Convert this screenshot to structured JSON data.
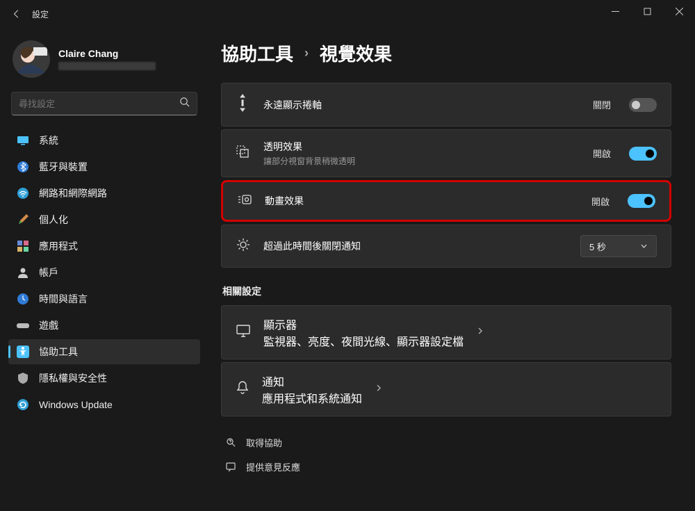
{
  "window": {
    "title": "設定"
  },
  "user": {
    "name": "Claire Chang"
  },
  "search": {
    "placeholder": "尋找設定"
  },
  "sidebar": {
    "items": [
      {
        "label": "系統"
      },
      {
        "label": "藍牙與裝置"
      },
      {
        "label": "網路和網際網路"
      },
      {
        "label": "個人化"
      },
      {
        "label": "應用程式"
      },
      {
        "label": "帳戶"
      },
      {
        "label": "時間與語言"
      },
      {
        "label": "遊戲"
      },
      {
        "label": "協助工具"
      },
      {
        "label": "隱私權與安全性"
      },
      {
        "label": "Windows Update"
      }
    ]
  },
  "breadcrumb": {
    "parent": "協助工具",
    "current": "視覺效果"
  },
  "settings": {
    "scrollbar": {
      "title": "永遠顯示捲軸",
      "state": "關閉"
    },
    "transparency": {
      "title": "透明效果",
      "sub": "讓部分視窗背景稍微透明",
      "state": "開啟"
    },
    "animation": {
      "title": "動畫效果",
      "state": "開啟"
    },
    "notify": {
      "title": "超過此時間後關閉通知",
      "value": "5 秒"
    }
  },
  "related": {
    "heading": "相關設定",
    "display": {
      "title": "顯示器",
      "sub": "監視器、亮度、夜間光線、顯示器設定檔"
    },
    "notifications": {
      "title": "通知",
      "sub": "應用程式和系統通知"
    }
  },
  "help": {
    "get": "取得協助",
    "feedback": "提供意見反應"
  }
}
